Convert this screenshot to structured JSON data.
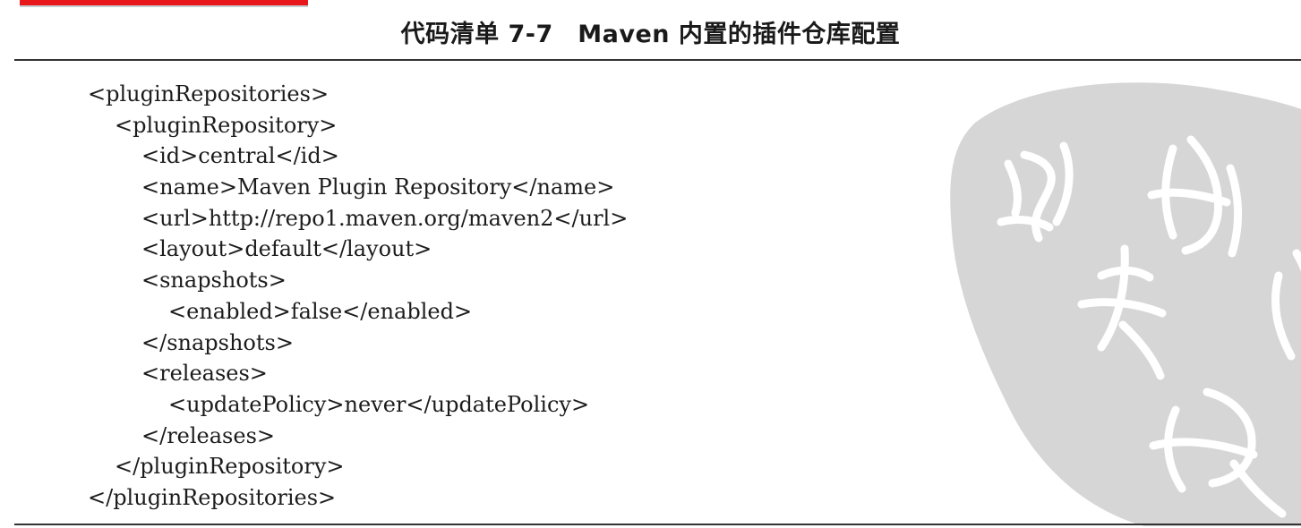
{
  "caption": "代码清单 7-7　Maven 内置的插件仓库配置",
  "code_lines": [
    "<pluginRepositories>",
    "<pluginRepository>",
    "<id>central</id>",
    "<name>Maven Plugin Repository</name>",
    "<url>http://repo1.maven.org/maven2</url>",
    "<layout>default</layout>",
    "<snapshots>",
    "<enabled>false</enabled>",
    "</snapshots>",
    "<releases>",
    "<updatePolicy>never</updatePolicy>",
    "</releases>",
    "</pluginRepository>",
    "</pluginRepositories>"
  ],
  "colors": {
    "highlight": "#e8171c",
    "text": "#1c1c1c",
    "seal": "#d9d9d9"
  }
}
